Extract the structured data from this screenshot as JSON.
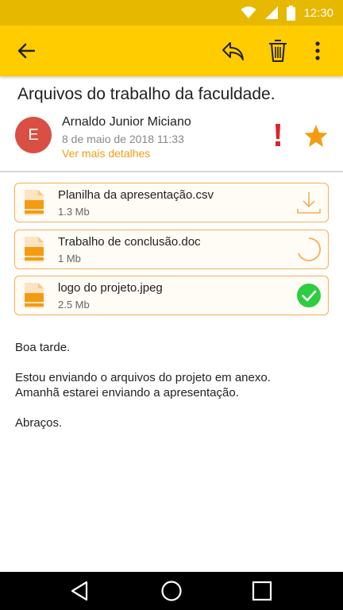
{
  "status_bar": {
    "time": "12:30",
    "icons": [
      "wifi-icon",
      "signal-icon",
      "battery-icon"
    ],
    "color": "#e6b800"
  },
  "app_bar": {
    "color": "#ffcc00",
    "icons": [
      "back-arrow-icon",
      "reply-icon",
      "trash-icon",
      "more-vert-icon"
    ]
  },
  "email": {
    "subject": "Arquivos do trabalho da faculdade.",
    "sender": {
      "avatar_letter": "E",
      "avatar_color": "#d94f43",
      "name": "Arnaldo Junior Miciano",
      "date": "8 de maio de 2018 11:33",
      "details_link": "Ver mais detalhes"
    },
    "flags": {
      "important_icon": "exclamation-icon",
      "star_icon": "star-icon",
      "accent": "#f39c12"
    },
    "attachments": [
      {
        "name": "Planilha da apresentação.csv",
        "size": "1.3 Mb",
        "state_icon": "download-icon"
      },
      {
        "name": "Trabalho de conclusão.doc",
        "size": "1 Mb",
        "state_icon": "loading-spinner-icon"
      },
      {
        "name": "logo do projeto.jpeg",
        "size": "2.5 Mb",
        "state_icon": "check-circle-icon"
      }
    ],
    "body": {
      "greeting": "Boa tarde.",
      "line1": "Estou enviando o arquivos  do projeto em anexo.",
      "line2": "Amanhã estarei enviando a apresentação.",
      "closing": "Abraços."
    }
  },
  "nav_bar": {
    "icons": [
      "back-triangle-icon",
      "home-circle-icon",
      "recents-square-icon"
    ]
  }
}
